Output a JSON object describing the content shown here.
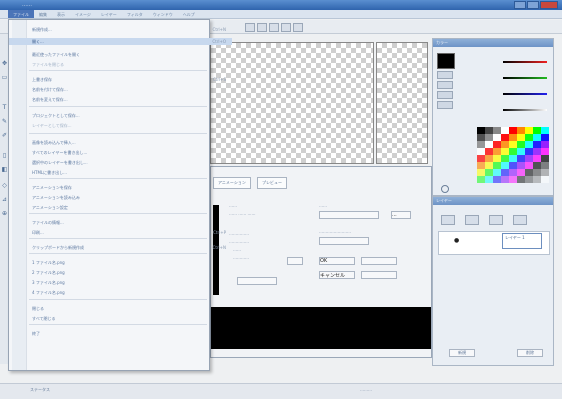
{
  "window": {
    "title": "……"
  },
  "menubar": {
    "items": [
      "ファイル",
      "編集",
      "表示",
      "イメージ",
      "レイヤー",
      "フィルタ",
      "ウィンドウ",
      "ヘルプ"
    ]
  },
  "file_menu": {
    "items": [
      {
        "label": "新規作成...",
        "shortcut": "Ctrl+N"
      },
      {
        "label": "開く...",
        "shortcut": "Ctrl+O"
      },
      {
        "label": "最近使ったファイルを開く",
        "shortcut": ""
      },
      {
        "label": "ファイルを閉じる",
        "shortcut": ""
      },
      {
        "label": "上書き保存",
        "shortcut": "Ctrl+S"
      },
      {
        "label": "名前を付けて保存...",
        "shortcut": ""
      },
      {
        "label": "名前を変えて保存...",
        "shortcut": ""
      },
      {
        "label": "プロジェクトとして保存...",
        "shortcut": ""
      },
      {
        "label": "レイヤーとして保存...",
        "shortcut": ""
      },
      {
        "label": "画像を読み込んで挿入...",
        "shortcut": ""
      },
      {
        "label": "すべてのレイヤーを書き出し...",
        "shortcut": ""
      },
      {
        "label": "選択中のレイヤーを書き出し...",
        "shortcut": ""
      },
      {
        "label": "HTMLに書き出し...",
        "shortcut": ""
      },
      {
        "label": "アニメーションを保存",
        "shortcut": ""
      },
      {
        "label": "アニメーションを読み込み",
        "shortcut": ""
      },
      {
        "label": "アニメーション設定",
        "shortcut": ""
      },
      {
        "label": "ファイルの情報...",
        "shortcut": ""
      },
      {
        "label": "印刷...",
        "shortcut": "Ctrl+P"
      },
      {
        "label": "クリップボードから新規作成",
        "shortcut": "Ctrl+N"
      },
      {
        "label": "1 ファイル名.png",
        "shortcut": ""
      },
      {
        "label": "2 ファイル名.png",
        "shortcut": ""
      },
      {
        "label": "3 ファイル名.png",
        "shortcut": ""
      },
      {
        "label": "4 ファイル名.png",
        "shortcut": ""
      },
      {
        "label": "閉じる",
        "shortcut": ""
      },
      {
        "label": "すべて閉じる",
        "shortcut": ""
      },
      {
        "label": "終了",
        "shortcut": ""
      }
    ]
  },
  "dialog": {
    "tab1": "アニメーション",
    "tab2": "プレビュー",
    "right_button": "...",
    "ok_label": "OK",
    "cancel_label": "キャンセル"
  },
  "layers_panel": {
    "title": "レイヤー",
    "layer_name": "レイヤー 1",
    "new_button": "新規",
    "delete_button": "削除"
  },
  "color_panel": {
    "title": "カラー"
  },
  "status": {
    "left": "ステータス",
    "right": "………"
  },
  "colors": {
    "titlebar": "#2f64ad",
    "menu_highlight": "#c7d8ee",
    "accent": "#4b74b8"
  }
}
